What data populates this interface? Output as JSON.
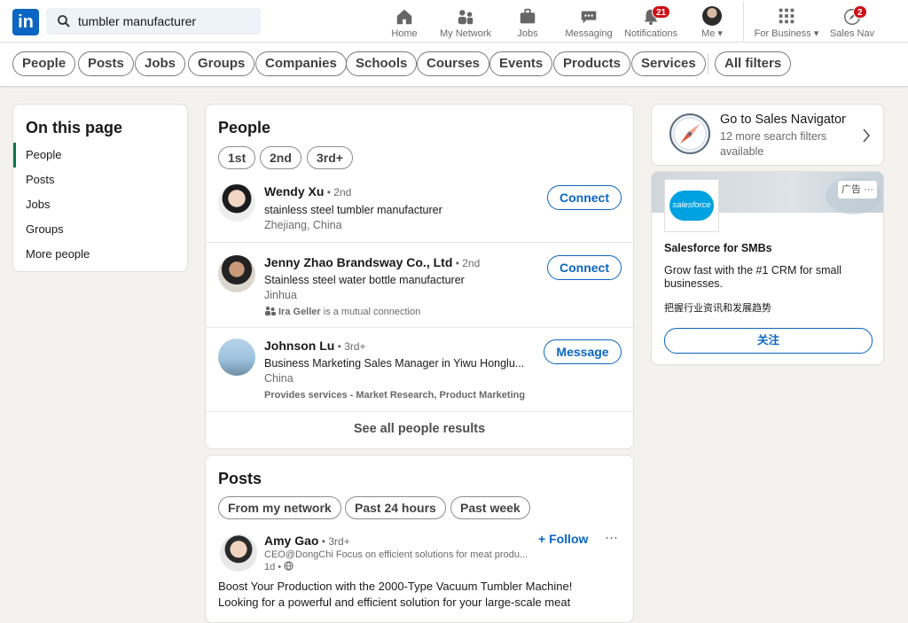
{
  "nav": {
    "logo_text": "in",
    "search_value": "tumbler manufacturer",
    "items": [
      {
        "label": "Home"
      },
      {
        "label": "My Network"
      },
      {
        "label": "Jobs"
      },
      {
        "label": "Messaging"
      },
      {
        "label": "Notifications",
        "badge": "21"
      },
      {
        "label": "Me ▾"
      },
      {
        "label": "For Business ▾"
      },
      {
        "label": "Sales Nav",
        "badge": "2"
      }
    ]
  },
  "filters": [
    "People",
    "Posts",
    "Jobs",
    "Groups",
    "Companies",
    "Schools",
    "Courses",
    "Events",
    "Products",
    "Services",
    "All filters"
  ],
  "on_this_page": {
    "title": "On this page",
    "links": [
      "People",
      "Posts",
      "Jobs",
      "Groups",
      "More people"
    ]
  },
  "people": {
    "title": "People",
    "degree_filters": [
      "1st",
      "2nd",
      "3rd+"
    ],
    "results": [
      {
        "name": "Wendy Xu",
        "degree": " • 2nd",
        "headline": "stainless steel tumbler manufacturer",
        "location": "Zhejiang, China",
        "extra": "",
        "action": "Connect"
      },
      {
        "name": "Jenny Zhao Brandsway Co., Ltd",
        "degree": " • 2nd",
        "headline": "Stainless steel water bottle manufacturer",
        "location": "Jinhua",
        "mutual_name": "Ira Geller",
        "mutual_rest": " is a mutual connection",
        "action": "Connect"
      },
      {
        "name": "Johnson Lu",
        "degree": " • 3rd+",
        "headline": "Business Marketing Sales Manager in Yiwu Honglu...",
        "location": "China",
        "extra": "Provides services - Market Research, Product Marketing",
        "action": "Message"
      }
    ],
    "see_all": "See all people results"
  },
  "posts": {
    "title": "Posts",
    "filters": [
      "From my network",
      "Past 24 hours",
      "Past week"
    ],
    "author": "Amy Gao",
    "degree": " • 3rd+",
    "author_headline": "CEO@DongChi Focus on efficient solutions for meat produ...",
    "time": "1d •",
    "follow": "+ Follow",
    "more": "···",
    "text1": "Boost Your Production with the 2000-Type Vacuum Tumbler Machine!",
    "text2": "Looking for a powerful and efficient solution for your large-scale meat"
  },
  "sales_nav": {
    "title": "Go to Sales Navigator",
    "subtitle1": "12 more search filters",
    "subtitle2": "available"
  },
  "ad": {
    "tag": "广告",
    "more": "···",
    "logo_text": "salesforce",
    "title": "Salesforce for SMBs",
    "body": "Grow fast with the #1 CRM for small businesses.",
    "subtext": "把握行业资讯和发展趋势",
    "button": "关注"
  },
  "colors": {
    "accent": "#0a66c2",
    "badge": "#cc1016",
    "salesforce": "#00a1e0"
  }
}
